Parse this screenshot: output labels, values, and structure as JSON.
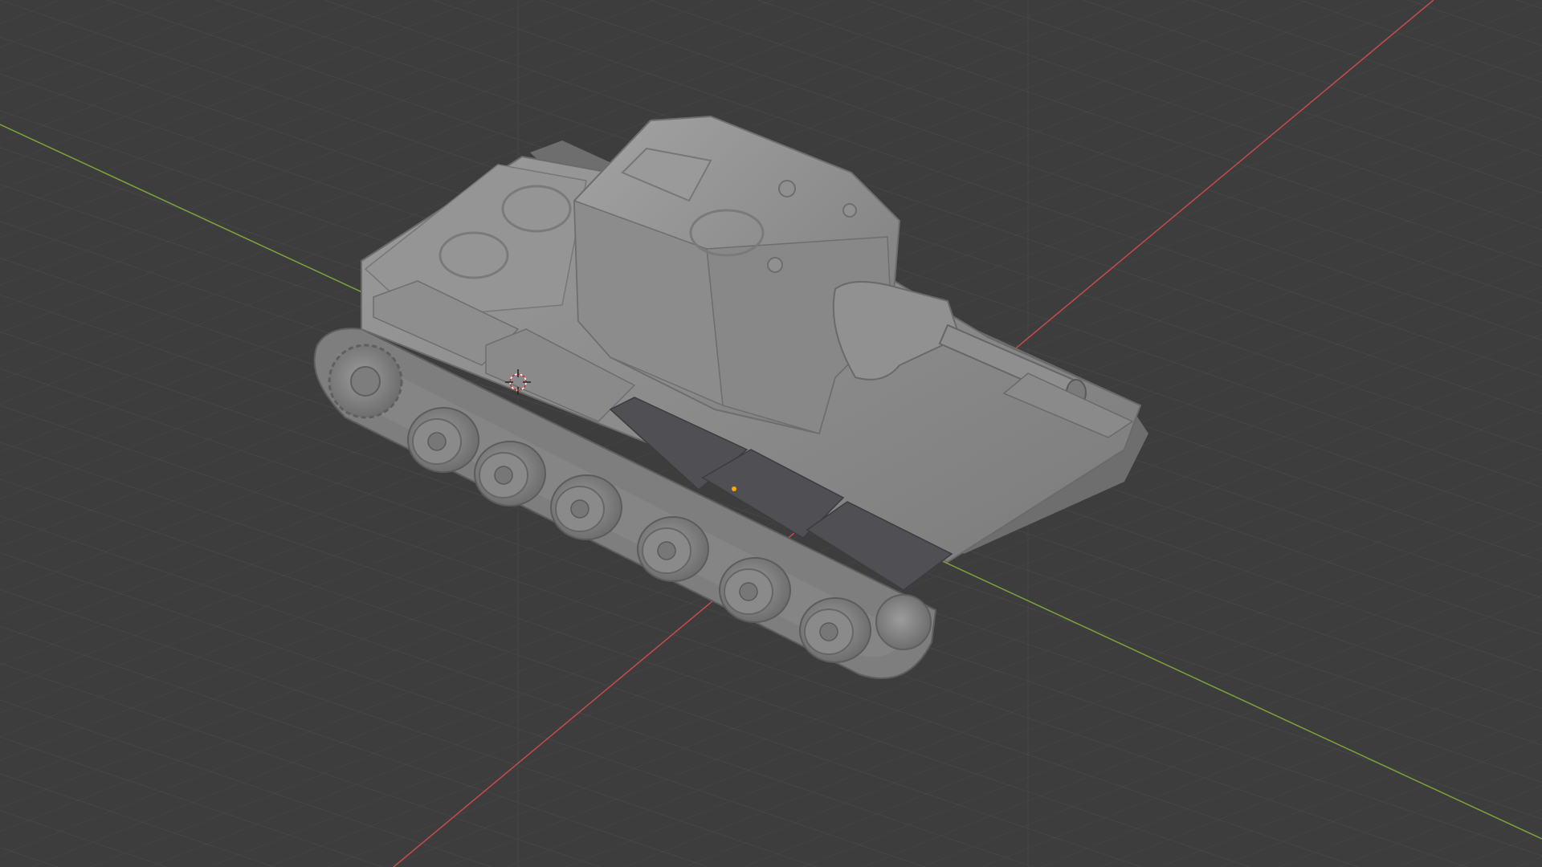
{
  "viewport": {
    "name": "3D Viewport",
    "background_color": "#3d3d3d",
    "grid_color": "#474747",
    "x_axis_color": "#c94a4a",
    "y_axis_color": "#7fa33a",
    "shading": "solid"
  },
  "scene": {
    "object": "tank-model",
    "object_color": "#8a8a8a",
    "object_dark": "#6f6f6f",
    "object_light": "#a9a9a9",
    "track_color": "#7e7e7e",
    "fender_panel_color": "#4f4f54",
    "origin_marker_color": "#ffa500",
    "cursor_icon": "3d-cursor-icon"
  }
}
